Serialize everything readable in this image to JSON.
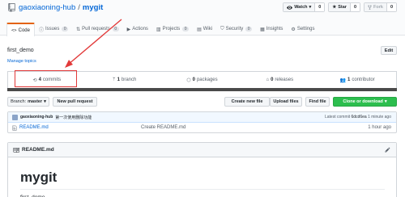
{
  "repo": {
    "owner": "gaoxiaoning-hub",
    "separator": "/",
    "name": "mygit"
  },
  "actions": [
    {
      "label": "Watch",
      "count": "0",
      "icon": "eye-icon"
    },
    {
      "label": "Star",
      "count": "0",
      "icon": "star-icon"
    },
    {
      "label": "Fork",
      "count": "0",
      "icon": "fork-icon"
    }
  ],
  "tabs": [
    {
      "label": "Code",
      "icon": "code-icon",
      "badge": ""
    },
    {
      "label": "Issues",
      "icon": "issue-icon",
      "badge": "0"
    },
    {
      "label": "Pull requests",
      "icon": "pull-request-icon",
      "badge": "0"
    },
    {
      "label": "Actions",
      "icon": "play-icon",
      "badge": ""
    },
    {
      "label": "Projects",
      "icon": "project-icon",
      "badge": "0"
    },
    {
      "label": "Wiki",
      "icon": "book-icon",
      "badge": ""
    },
    {
      "label": "Security",
      "icon": "shield-icon",
      "badge": "0"
    },
    {
      "label": "Insights",
      "icon": "graph-icon",
      "badge": ""
    },
    {
      "label": "Settings",
      "icon": "gear-icon",
      "badge": ""
    }
  ],
  "description": "first_demo",
  "manage_topics": "Manage topics",
  "edit_label": "Edit",
  "summary": [
    {
      "value": "4",
      "label": "commits",
      "icon": "history-icon"
    },
    {
      "value": "1",
      "label": "branch",
      "icon": "branch-icon"
    },
    {
      "value": "0",
      "label": "packages",
      "icon": "package-icon"
    },
    {
      "value": "0",
      "label": "releases",
      "icon": "tag-icon"
    },
    {
      "value": "1",
      "label": "contributor",
      "icon": "people-icon"
    }
  ],
  "toolbar": {
    "branch_label": "Branch:",
    "branch_value": "master",
    "new_pr": "New pull request",
    "create_file": "Create new file",
    "upload_files": "Upload files",
    "find_file": "Find file",
    "clone": "Clone or download"
  },
  "latest_commit": {
    "author": "gaoxiaoning-hub",
    "message": "第一次使用删除功能",
    "latest_label": "Latest commit",
    "sha": "6dcd6ea",
    "age": "1 minute ago"
  },
  "files": [
    {
      "name": "README.md",
      "message": "Create README.md",
      "age": "1 hour ago"
    }
  ],
  "readme": {
    "filename": "README.md",
    "heading": "mygit",
    "text": "first_demo"
  },
  "colors": {
    "link": "#0366d6",
    "accent": "#e36209",
    "green": "#2cbe4e",
    "annotation": "#e23a3a"
  }
}
